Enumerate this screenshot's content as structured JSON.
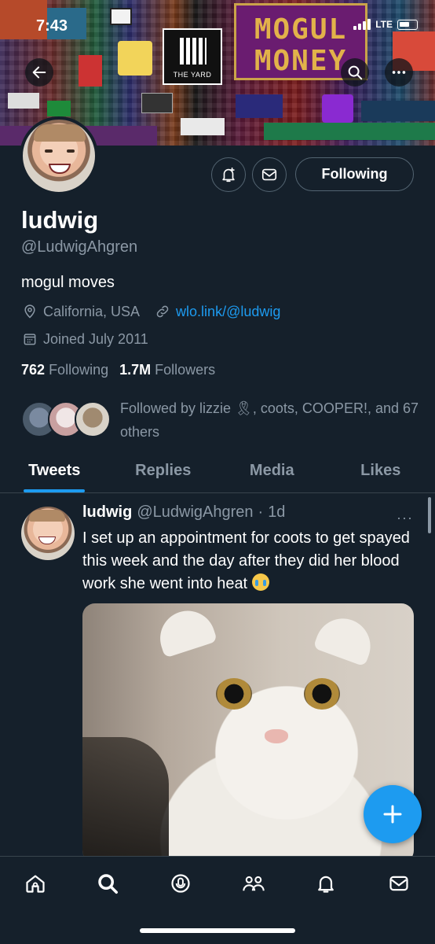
{
  "status_bar": {
    "time": "7:43",
    "network": "LTE"
  },
  "banner": {
    "yard_text": "THE YARD",
    "mogul_line1": "MOGUL",
    "mogul_line2": "MONEY"
  },
  "profile": {
    "name": "ludwig",
    "handle": "@LudwigAhgren",
    "bio": "mogul moves",
    "location": "California, USA",
    "website": "wlo.link/@ludwig",
    "joined": "Joined July 2011",
    "following_count": "762",
    "following_label": "Following",
    "followers_count": "1.7M",
    "followers_label": "Followers",
    "follow_button_label": "Following",
    "followed_by_text": "Followed by lizzie 🎗, coots, COOPER!, and 67 others"
  },
  "tabs": [
    {
      "label": "Tweets",
      "active": true
    },
    {
      "label": "Replies",
      "active": false
    },
    {
      "label": "Media",
      "active": false
    },
    {
      "label": "Likes",
      "active": false
    }
  ],
  "tweet": {
    "author_name": "ludwig",
    "author_handle": "@LudwigAhgren",
    "separator": "·",
    "time": "1d",
    "more": "···",
    "text": "I set up an appointment for coots to get spayed this week and the day after they did her blood work she went into heat",
    "emoji_name": "loudly-crying-face"
  },
  "bottom_nav": [
    "home-icon",
    "search-icon",
    "spaces-icon",
    "communities-icon",
    "notifications-icon",
    "messages-icon"
  ],
  "colors": {
    "background": "#15202b",
    "accent": "#1d9bf0",
    "secondary_text": "#8b98a5",
    "border": "#38444d"
  }
}
